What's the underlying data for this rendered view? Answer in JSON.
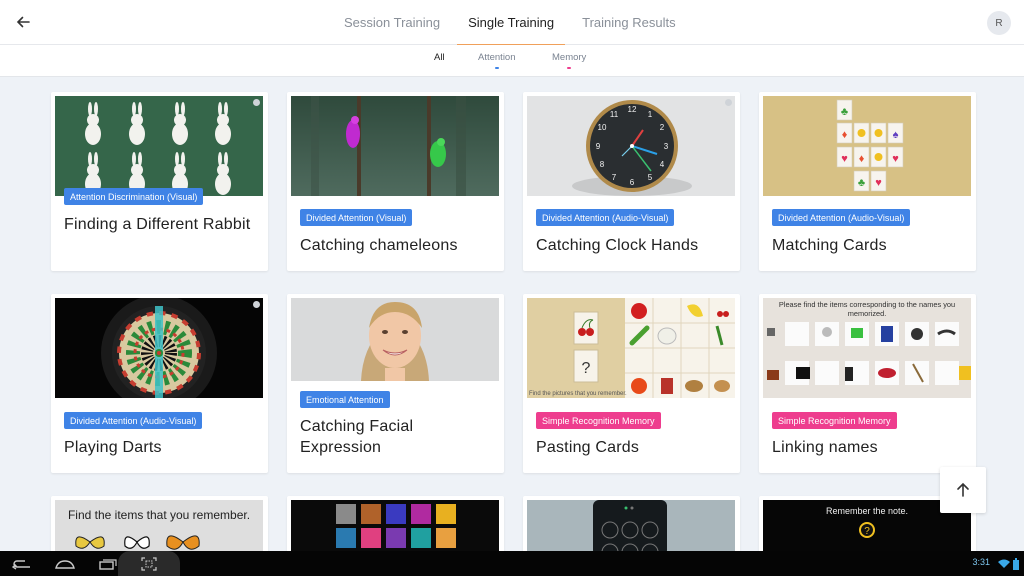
{
  "header": {
    "tabs": [
      {
        "label": "Session Training"
      },
      {
        "label": "Single Training"
      },
      {
        "label": "Training Results"
      }
    ],
    "active_tab": 1,
    "avatar_initial": "R",
    "accent": "#f0a05a"
  },
  "filters": {
    "items": [
      {
        "label": "All",
        "color": "#222222"
      },
      {
        "label": "Attention",
        "color": "#3f83e6"
      },
      {
        "label": "Memory",
        "color": "#ee3d8e"
      }
    ],
    "active": 0
  },
  "cards": [
    {
      "badge": "Attention Discrimination (Visual)",
      "badge_color": "blue",
      "title": "Finding a Different Rabbit"
    },
    {
      "badge": "Divided Attention (Visual)",
      "badge_color": "blue",
      "title": "Catching chameleons"
    },
    {
      "badge": "Divided Attention (Audio-Visual)",
      "badge_color": "blue",
      "title": "Catching Clock Hands"
    },
    {
      "badge": "Divided Attention (Audio-Visual)",
      "badge_color": "blue",
      "title": "Matching Cards"
    },
    {
      "badge": "Divided Attention (Audio-Visual)",
      "badge_color": "blue",
      "title": "Playing Darts"
    },
    {
      "badge": "Emotional Attention",
      "badge_color": "blue",
      "title": "Catching Facial Expression"
    },
    {
      "badge": "Simple Recognition Memory",
      "badge_color": "pink",
      "title": "Pasting Cards"
    },
    {
      "badge": "Simple Recognition Memory",
      "badge_color": "pink",
      "title": "Linking names"
    }
  ],
  "thumb_text": {
    "clock_numbers": [
      "12",
      "1",
      "2",
      "3",
      "4",
      "5",
      "6",
      "7",
      "8",
      "9",
      "10",
      "11"
    ],
    "pasting_caption": "Find the pictures that you remember.",
    "linking_caption": "Please find the items corresponding to the names you memorized.",
    "butterfly_caption": "Find the items that you remember.",
    "note_caption": "Remember the note.",
    "question_mark": "?"
  },
  "statusbar": {
    "time": "3:31"
  }
}
